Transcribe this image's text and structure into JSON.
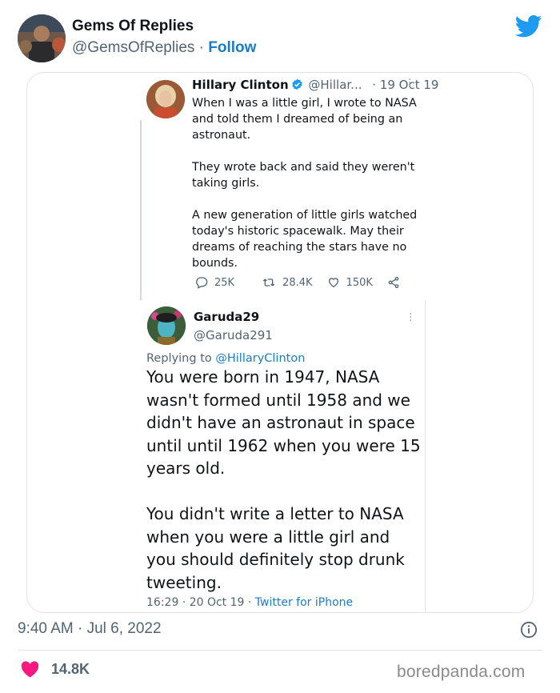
{
  "embed_header": {
    "name": "Gems Of Replies",
    "handle": "@GemsOfReplies",
    "separator": "·",
    "follow_label": "Follow",
    "bird_icon": "twitter-bird-icon",
    "brand_color": "#1d9bf0"
  },
  "quoted_tweet": {
    "name": "Hillary Clinton",
    "verified": true,
    "handle": "@Hillar...",
    "date": "· 19 Oct 19",
    "more_icon": "more-vertical-icon",
    "paragraphs": [
      "When I was a little girl, I wrote to NASA and told them I dreamed of being an astronaut.",
      "They wrote back and said they weren't taking girls.",
      "A new generation of little girls watched today's historic spacewalk. May their dreams of reaching the stars have no bounds."
    ],
    "actions": {
      "replies": "25K",
      "retweets": "28.4K",
      "likes": "150K"
    }
  },
  "reply_tweet": {
    "name": "Garuda29",
    "handle": "@Garuda291",
    "replying_prefix": "Replying to",
    "replying_to": "@HillaryClinton",
    "paragraphs": [
      "You were born in 1947, NASA wasn't formed until 1958 and we didn't have an astronaut in space until until 1962 when you were 15 years old.",
      "You didn't write a letter to NASA when you were a little girl and you should definitely stop drunk tweeting."
    ],
    "time": "16:29 · 20 Oct 19 · ",
    "source": "Twitter for iPhone",
    "link_color": "#1b7cc4"
  },
  "footer": {
    "timestamp": "9:40 AM · Jul 6, 2022",
    "like_count": "14.8K",
    "heart_color": "#f91880",
    "watermark": "boredpanda.com"
  }
}
